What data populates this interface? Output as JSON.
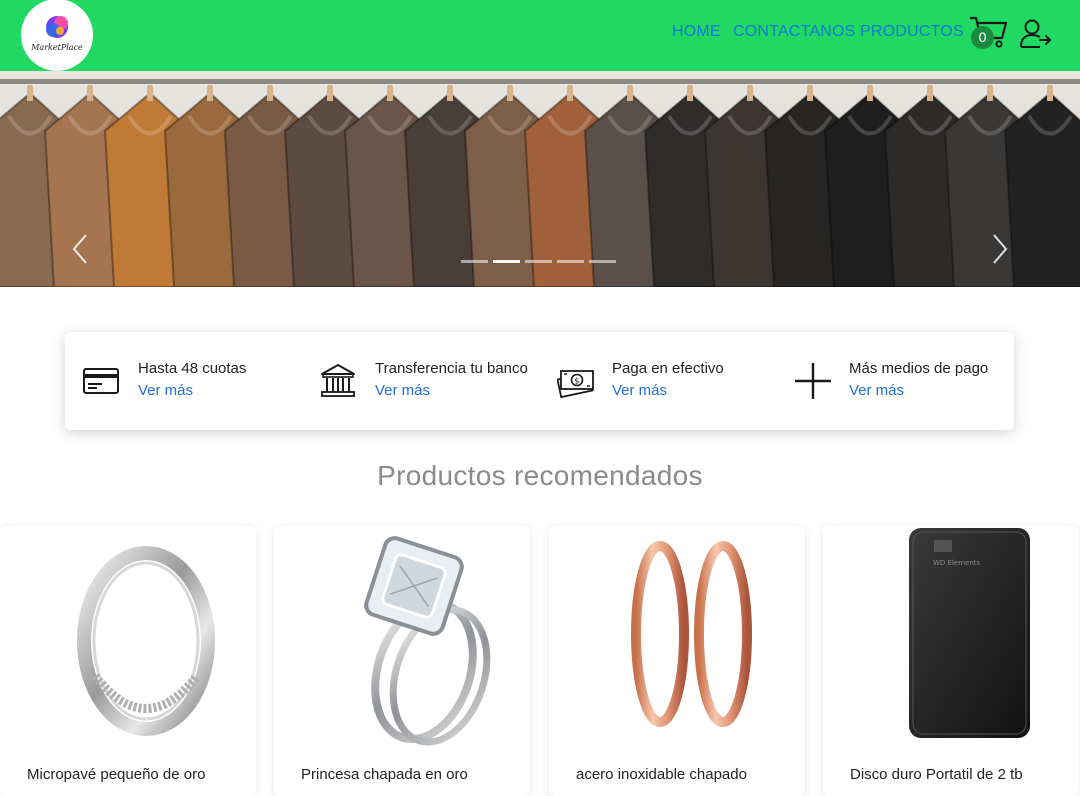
{
  "header": {
    "logo_text": "MarketPlace",
    "nav": [
      "HOME",
      "CONTACTANOS",
      "PRODUCTOS"
    ],
    "cart_count": "0",
    "colors": {
      "bar": "#1fd962",
      "link": "#1577d6",
      "badge": "#1a8a3f"
    }
  },
  "carousel": {
    "slide_count": 5,
    "active_slide": 2
  },
  "payments": [
    {
      "icon": "credit-card-icon",
      "title": "Hasta 48 cuotas",
      "link": "Ver más"
    },
    {
      "icon": "bank-icon",
      "title": "Transferencia tu banco",
      "link": "Ver más"
    },
    {
      "icon": "cash-icon",
      "title": "Paga en efectivo",
      "link": "Ver más"
    },
    {
      "icon": "plus-icon",
      "title": "Más medios de pago",
      "link": "Ver más"
    }
  ],
  "recommended": {
    "title": "Productos recomendados",
    "products": [
      {
        "image": "silver-ring-image",
        "name": "Micropavé pequeño de oro"
      },
      {
        "image": "diamond-ring-image",
        "name": "Princesa chapada en oro"
      },
      {
        "image": "rose-gold-rings-image",
        "name": "acero inoxidable chapado"
      },
      {
        "image": "hard-drive-image",
        "name": "Disco duro Portatil de 2 tb",
        "brand": "WD Elements"
      }
    ]
  }
}
